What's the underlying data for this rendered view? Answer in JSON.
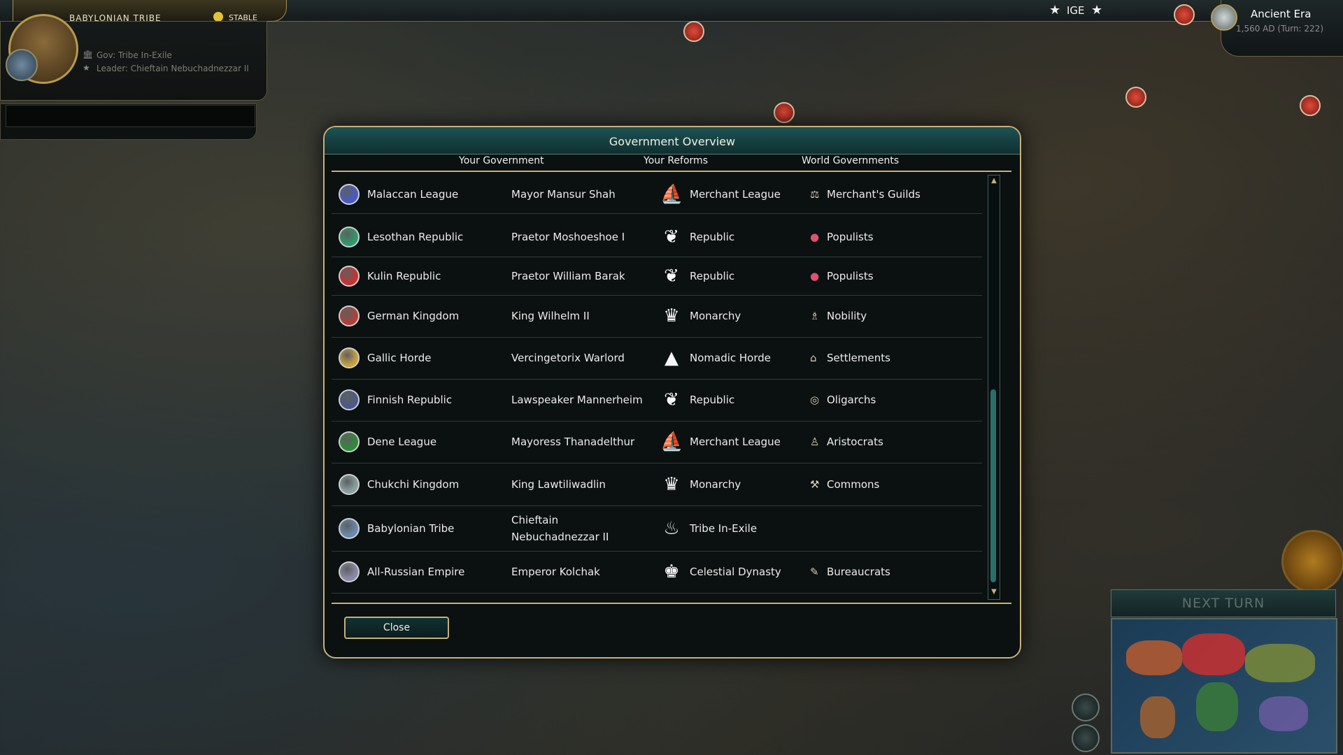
{
  "top_bar": {
    "civ_name": "BABYLONIAN TRIBE",
    "stability": "STABLE",
    "ige_label": "IGE",
    "era": "Ancient Era",
    "date": "1,560 AD (Turn: 222)"
  },
  "leader_panel": {
    "gov": "Gov: Tribe In-Exile",
    "leader": "Leader: Chieftain Nebuchadnezzar II"
  },
  "dialog": {
    "title": "Government Overview",
    "tabs": [
      "Your Government",
      "Your Reforms",
      "World Governments"
    ],
    "close_label": "Close",
    "rows": [
      {
        "civ": "Malaccan League",
        "leader": "Mayor Mansur Shah",
        "government": "Merchant League",
        "government_icon": "ship-icon",
        "faction": "Merchant's Guilds",
        "faction_icon": "scales-icon",
        "civ_color": "#4a5ac8"
      },
      {
        "civ": "Lesothan Republic",
        "leader": "Praetor Moshoeshoe I",
        "government": "Republic",
        "government_icon": "laurel-icon",
        "faction": "Populists",
        "faction_icon": "people-icon",
        "civ_color": "#2f9a6a"
      },
      {
        "civ": "Kulin Republic",
        "leader": "Praetor William Barak",
        "government": "Republic",
        "government_icon": "laurel-icon",
        "faction": "Populists",
        "faction_icon": "people-icon",
        "civ_color": "#c83232"
      },
      {
        "civ": "German Kingdom",
        "leader": "King Wilhelm II",
        "government": "Monarchy",
        "government_icon": "crown-icon",
        "faction": "Nobility",
        "faction_icon": "noble-icon",
        "civ_color": "#b04038"
      },
      {
        "civ": "Gallic Horde",
        "leader": "Vercingetorix Warlord",
        "government": "Nomadic Horde",
        "government_icon": "tent-icon",
        "faction": "Settlements",
        "faction_icon": "hut-icon",
        "civ_color": "#c8a040"
      },
      {
        "civ": "Finnish Republic",
        "leader": "Lawspeaker Mannerheim",
        "government": "Republic",
        "government_icon": "laurel-icon",
        "faction": "Oligarchs",
        "faction_icon": "ring-icon",
        "civ_color": "#4a5a8a"
      },
      {
        "civ": "Dene League",
        "leader": "Mayoress Thanadelthur",
        "government": "Merchant League",
        "government_icon": "ship-icon",
        "faction": "Aristocrats",
        "faction_icon": "aristocrat-icon",
        "civ_color": "#2f8a3a"
      },
      {
        "civ": "Chukchi Kingdom",
        "leader": "King Lawtiliwadlin",
        "government": "Monarchy",
        "government_icon": "crown-icon",
        "faction": "Commons",
        "faction_icon": "plow-icon",
        "civ_color": "#8aa0a0"
      },
      {
        "civ": "Babylonian Tribe",
        "leader": "Chieftain Nebuchadnezzar II",
        "government": "Tribe In-Exile",
        "government_icon": "campfire-icon",
        "faction": "",
        "faction_icon": "",
        "civ_color": "#6a8ab0"
      },
      {
        "civ": "All-Russian Empire",
        "leader": "Emperor Kolchak",
        "government": "Celestial Dynasty",
        "government_icon": "dynasty-crown-icon",
        "faction": "Bureaucrats",
        "faction_icon": "quill-icon",
        "civ_color": "#8a8aa8"
      }
    ]
  },
  "bottom_right": {
    "next_turn": "NEXT TURN"
  }
}
